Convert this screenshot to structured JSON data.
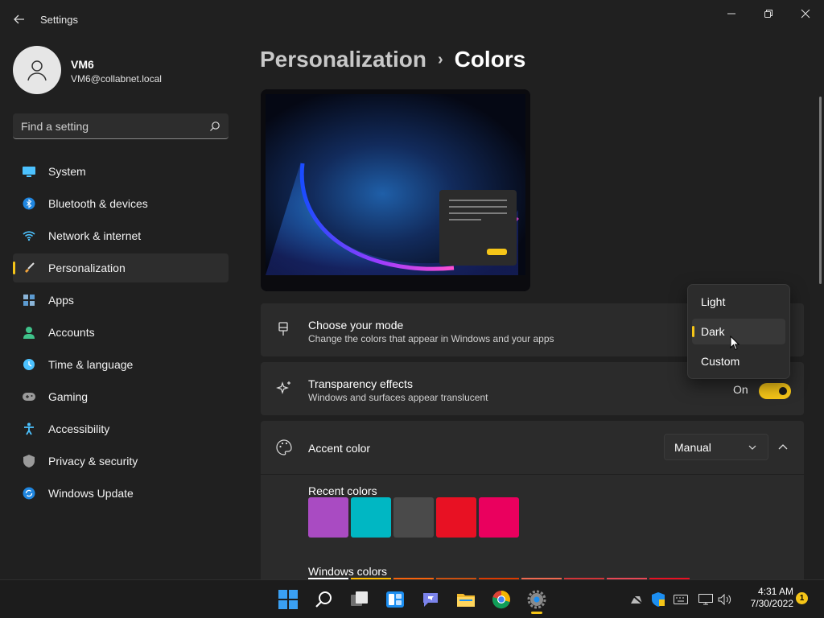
{
  "window": {
    "title": "Settings"
  },
  "user": {
    "name": "VM6",
    "email": "VM6@collabnet.local"
  },
  "search": {
    "placeholder": "Find a setting"
  },
  "sidebar": {
    "items": [
      {
        "label": "System",
        "icon": "monitor-icon"
      },
      {
        "label": "Bluetooth & devices",
        "icon": "bluetooth-icon"
      },
      {
        "label": "Network & internet",
        "icon": "wifi-icon"
      },
      {
        "label": "Personalization",
        "icon": "paintbrush-icon",
        "active": true
      },
      {
        "label": "Apps",
        "icon": "apps-icon"
      },
      {
        "label": "Accounts",
        "icon": "person-icon"
      },
      {
        "label": "Time & language",
        "icon": "clock-globe-icon"
      },
      {
        "label": "Gaming",
        "icon": "gamepad-icon"
      },
      {
        "label": "Accessibility",
        "icon": "accessibility-icon"
      },
      {
        "label": "Privacy & security",
        "icon": "shield-icon"
      },
      {
        "label": "Windows Update",
        "icon": "update-icon"
      }
    ]
  },
  "breadcrumb": {
    "parent": "Personalization",
    "separator": "›",
    "current": "Colors"
  },
  "mode_card": {
    "title": "Choose your mode",
    "subtitle": "Change the colors that appear in Windows and your apps"
  },
  "mode_menu": {
    "options": [
      "Light",
      "Dark",
      "Custom"
    ],
    "selected": "Dark"
  },
  "transparency_card": {
    "title": "Transparency effects",
    "subtitle": "Windows and surfaces appear translucent",
    "state": "On"
  },
  "accent_card": {
    "title": "Accent color",
    "dropdown_value": "Manual"
  },
  "recent_colors": {
    "label": "Recent colors",
    "colors": [
      "#a94bc2",
      "#00b7c3",
      "#4a4a4a",
      "#e81123",
      "#ea005e"
    ]
  },
  "windows_colors": {
    "label": "Windows colors"
  },
  "taskbar": {
    "time": "4:31 AM",
    "date": "7/30/2022",
    "notification_count": "1"
  },
  "colors": {
    "accent": "#f5c518",
    "background": "#202020",
    "card": "#2b2b2b"
  }
}
